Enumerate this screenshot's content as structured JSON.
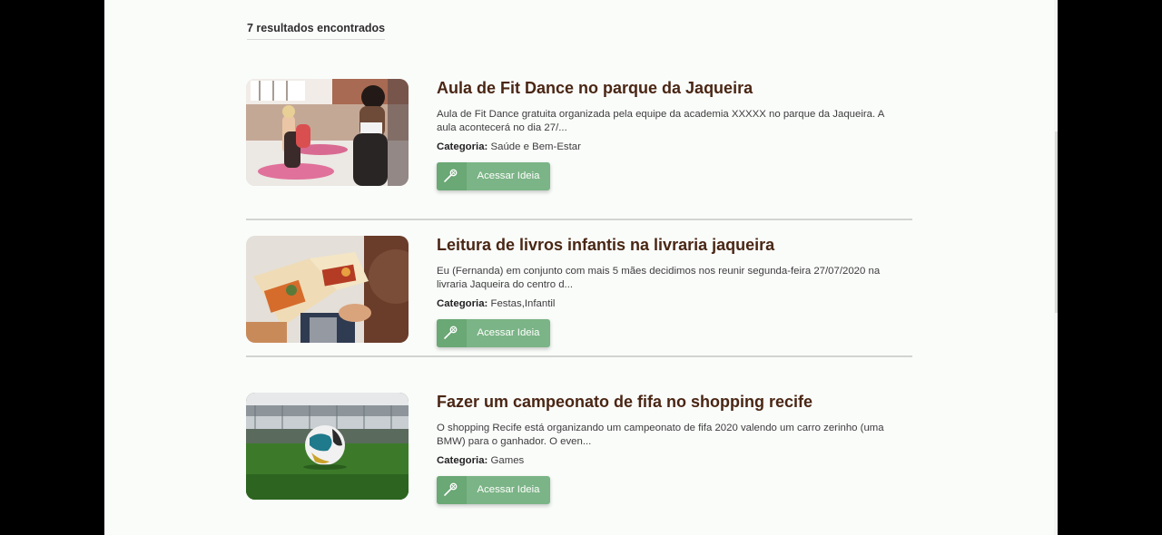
{
  "results": {
    "count_label": "7 resultados encontrados"
  },
  "ideas": [
    {
      "title": "Aula de Fit Dance no parque da Jaqueira",
      "description": "Aula de Fit Dance gratuita organizada pela equipe da academia XXXXX no parque da Jaqueira. A aula acontecerá no dia 27/...",
      "category_label": "Categoria:",
      "category": "Saúde e Bem-Estar",
      "button_label": "Acessar Ideia",
      "image_icon": "fitness-class-photo"
    },
    {
      "title": "Leitura de livros infantis na livraria jaqueira",
      "description": "Eu (Fernanda) em conjunto com mais 5 mães decidimos nos reunir segunda-feira 27/07/2020 na livraria Jaqueira do centro d...",
      "category_label": "Categoria:",
      "category": "Festas,Infantil",
      "button_label": "Acessar Ideia",
      "image_icon": "children-book-photo"
    },
    {
      "title": "Fazer um campeonato de fifa no shopping recife",
      "description": "O shopping Recife está organizando um campeonato de fifa 2020 valendo um carro zerinho (uma BMW) para o ganhador. O even...",
      "category_label": "Categoria:",
      "category": "Games",
      "button_label": "Acessar Ideia",
      "image_icon": "soccer-stadium-photo"
    }
  ],
  "colors": {
    "title": "#4a2614",
    "button": "#7bb486",
    "background": "#fafcfa"
  }
}
